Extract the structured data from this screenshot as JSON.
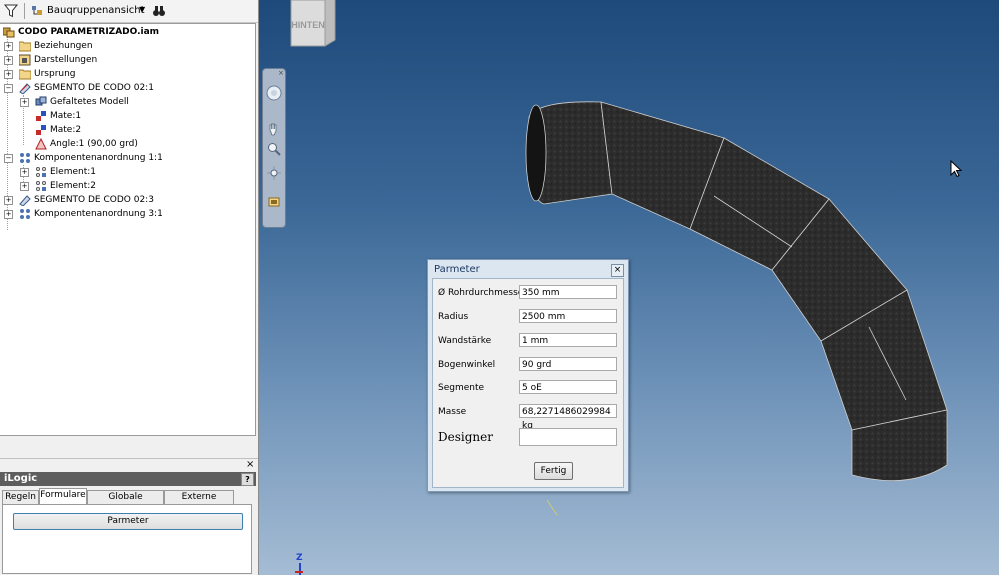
{
  "toolbar": {
    "view_label": "Bauqruppenansicht"
  },
  "tree": {
    "root": "CODO PARAMETRIZADO.iam",
    "beziehungen": "Beziehungen",
    "darstellungen": "Darstellungen",
    "ursprung": "Ursprung",
    "segment1": "SEGMENTO DE CODO 02:1",
    "gefaltetes": "Gefaltetes Modell",
    "mate1": "Mate:1",
    "mate2": "Mate:2",
    "angle": "Angle:1 (90,00 grd)",
    "komp1": "Komponentenanordnung 1:1",
    "element1": "Element:1",
    "element2": "Element:2",
    "segment3": "SEGMENTO DE CODO 02:3",
    "komp3": "Komponentenanordnung 3:1"
  },
  "ilogic": {
    "title": "iLogic",
    "help": "?",
    "close": "×",
    "tabs": [
      "Regeln",
      "Formulare",
      "Globale Formulare",
      "Externe Regeln"
    ],
    "active_tab": "Formulare",
    "rule_button": "Parmeter"
  },
  "viewcube": {
    "label": "HINTEN"
  },
  "axis": {
    "z": "Z"
  },
  "dialog": {
    "title": "Parmeter",
    "close": "×",
    "fields": [
      {
        "label": "Ø Rohrdurchmesser",
        "value": "350 mm"
      },
      {
        "label": "Radius",
        "value": "2500 mm"
      },
      {
        "label": "Wandstärke",
        "value": "1 mm"
      },
      {
        "label": "Bogenwinkel",
        "value": "90 grd"
      },
      {
        "label": "Segmente",
        "value": "5 oE"
      },
      {
        "label": "Masse",
        "value": "68,2271486029984 kg"
      },
      {
        "label": "Designer",
        "value": ""
      }
    ],
    "done_button": "Fertig"
  }
}
